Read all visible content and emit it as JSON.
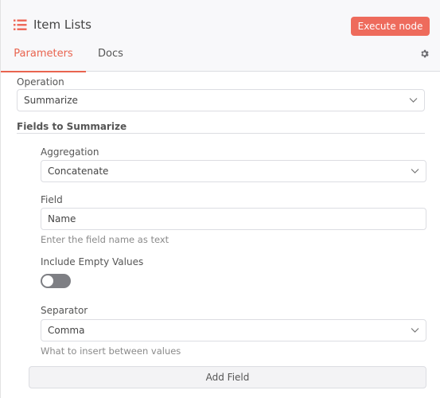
{
  "header": {
    "title": "Item Lists",
    "execute_label": "Execute node",
    "accent_color": "#ee6b5c"
  },
  "tabs": [
    {
      "label": "Parameters",
      "active": true
    },
    {
      "label": "Docs",
      "active": false
    }
  ],
  "operation": {
    "label": "Operation",
    "value": "Summarize"
  },
  "fields_to_summarize": {
    "title": "Fields to Summarize",
    "aggregation": {
      "label": "Aggregation",
      "value": "Concatenate"
    },
    "field": {
      "label": "Field",
      "value": "Name",
      "hint": "Enter the field name as text"
    },
    "include_empty": {
      "label": "Include Empty Values",
      "on": false
    },
    "separator": {
      "label": "Separator",
      "value": "Comma",
      "hint": "What to insert between values"
    },
    "add_field_label": "Add Field"
  },
  "icons": {
    "node": "list-icon",
    "settings": "gear-icon",
    "dropdown": "chevron-down-icon"
  }
}
